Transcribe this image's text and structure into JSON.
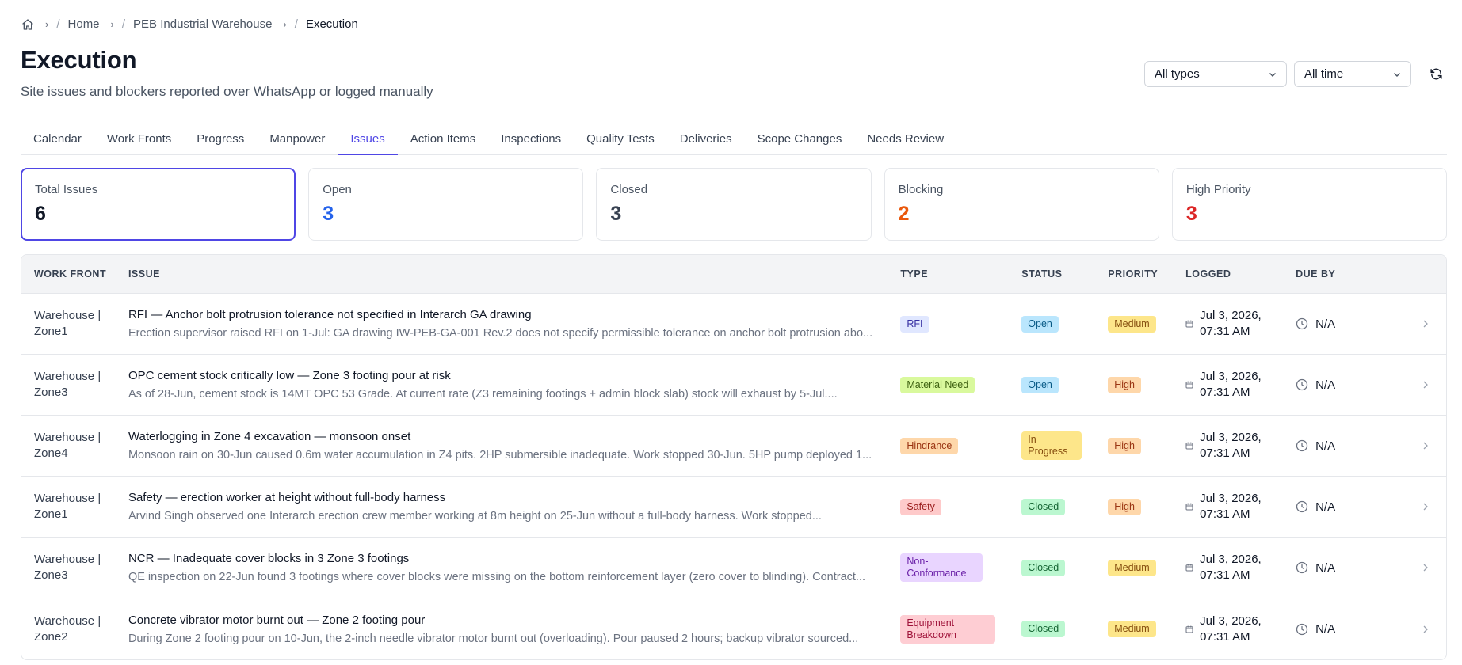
{
  "breadcrumb": {
    "items": [
      "Home",
      "PEB Industrial Warehouse",
      "Execution"
    ]
  },
  "header": {
    "title": "Execution",
    "subtitle": "Site issues and blockers reported over WhatsApp or logged manually"
  },
  "filters": {
    "type_value": "All types",
    "time_value": "All time"
  },
  "tabs": [
    "Calendar",
    "Work Fronts",
    "Progress",
    "Manpower",
    "Issues",
    "Action Items",
    "Inspections",
    "Quality Tests",
    "Deliveries",
    "Scope Changes",
    "Needs Review"
  ],
  "active_tab": "Issues",
  "stats": [
    {
      "label": "Total Issues",
      "value": "6",
      "color": "#111827"
    },
    {
      "label": "Open",
      "value": "3",
      "color": "#2563eb"
    },
    {
      "label": "Closed",
      "value": "3",
      "color": "#374151"
    },
    {
      "label": "Blocking",
      "value": "2",
      "color": "#ea580c"
    },
    {
      "label": "High Priority",
      "value": "3",
      "color": "#dc2626"
    }
  ],
  "table": {
    "headers": {
      "work_front": "WORK FRONT",
      "issue": "ISSUE",
      "type": "TYPE",
      "status": "STATUS",
      "priority": "PRIORITY",
      "logged": "LOGGED",
      "due_by": "DUE BY"
    },
    "rows": [
      {
        "wf1": "Warehouse |",
        "wf2": "Zone1",
        "title": "RFI — Anchor bolt protrusion tolerance not specified in Interarch GA drawing",
        "desc": "Erection supervisor raised RFI on 1-Jul: GA drawing IW-PEB-GA-001 Rev.2 does not specify permissible tolerance on anchor bolt protrusion abo...",
        "type": "RFI",
        "status": "Open",
        "priority": "Medium",
        "logged1": "Jul 3, 2026,",
        "logged2": "07:31 AM",
        "due": "N/A"
      },
      {
        "wf1": "Warehouse |",
        "wf2": "Zone3",
        "title": "OPC cement stock critically low — Zone 3 footing pour at risk",
        "desc": "As of 28-Jun, cement stock is 14MT OPC 53 Grade. At current rate (Z3 remaining footings + admin block slab) stock will exhaust by 5-Jul....",
        "type": "Material Need",
        "status": "Open",
        "priority": "High",
        "logged1": "Jul 3, 2026,",
        "logged2": "07:31 AM",
        "due": "N/A"
      },
      {
        "wf1": "Warehouse |",
        "wf2": "Zone4",
        "title": "Waterlogging in Zone 4 excavation — monsoon onset",
        "desc": "Monsoon rain on 30-Jun caused 0.6m water accumulation in Z4 pits. 2HP submersible inadequate. Work stopped 30-Jun. 5HP pump deployed 1...",
        "type": "Hindrance",
        "status": "In Progress",
        "priority": "High",
        "logged1": "Jul 3, 2026,",
        "logged2": "07:31 AM",
        "due": "N/A"
      },
      {
        "wf1": "Warehouse |",
        "wf2": "Zone1",
        "title": "Safety — erection worker at height without full-body harness",
        "desc": "Arvind Singh observed one Interarch erection crew member working at 8m height on 25-Jun without a full-body harness. Work stopped...",
        "type": "Safety",
        "status": "Closed",
        "priority": "High",
        "logged1": "Jul 3, 2026,",
        "logged2": "07:31 AM",
        "due": "N/A"
      },
      {
        "wf1": "Warehouse |",
        "wf2": "Zone3",
        "title": "NCR — Inadequate cover blocks in 3 Zone 3 footings",
        "desc": "QE inspection on 22-Jun found 3 footings where cover blocks were missing on the bottom reinforcement layer (zero cover to blinding). Contract...",
        "type": "Non-Conformance",
        "status": "Closed",
        "priority": "Medium",
        "logged1": "Jul 3, 2026,",
        "logged2": "07:31 AM",
        "due": "N/A"
      },
      {
        "wf1": "Warehouse |",
        "wf2": "Zone2",
        "title": "Concrete vibrator motor burnt out — Zone 2 footing pour",
        "desc": "During Zone 2 footing pour on 10-Jun, the 2-inch needle vibrator motor burnt out (overloading). Pour paused 2 hours; backup vibrator sourced...",
        "type": "Equipment Breakdown",
        "status": "Closed",
        "priority": "Medium",
        "logged1": "Jul 3, 2026,",
        "logged2": "07:31 AM",
        "due": "N/A"
      }
    ]
  },
  "colors": {
    "accent": "#4f46e5"
  }
}
